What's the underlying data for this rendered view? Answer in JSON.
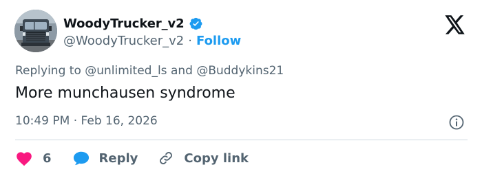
{
  "author": {
    "display_name": "WoodyTrucker_v2",
    "handle": "@WoodyTrucker_v2",
    "separator": "·",
    "follow_label": "Follow",
    "verified": true
  },
  "reply_context": {
    "prefix": "Replying to",
    "users": [
      "@unlimited_ls",
      "@Buddykins21"
    ],
    "joiner": "and"
  },
  "tweet": {
    "text": "More munchausen syndrome",
    "time": "10:49 PM",
    "separator": "·",
    "date": "Feb 16, 2026"
  },
  "actions": {
    "like_count": "6",
    "reply_label": "Reply",
    "copy_link_label": "Copy link"
  },
  "icons": {
    "logo": "x-logo-icon",
    "verified": "verified-badge-icon",
    "info": "info-icon",
    "like": "heart-icon",
    "reply": "speech-bubble-icon",
    "copy_link": "link-icon"
  },
  "colors": {
    "text": "#0f1419",
    "secondary": "#536471",
    "accent": "#1d9bf0",
    "like": "#f91880",
    "divider": "#cfd9de"
  }
}
